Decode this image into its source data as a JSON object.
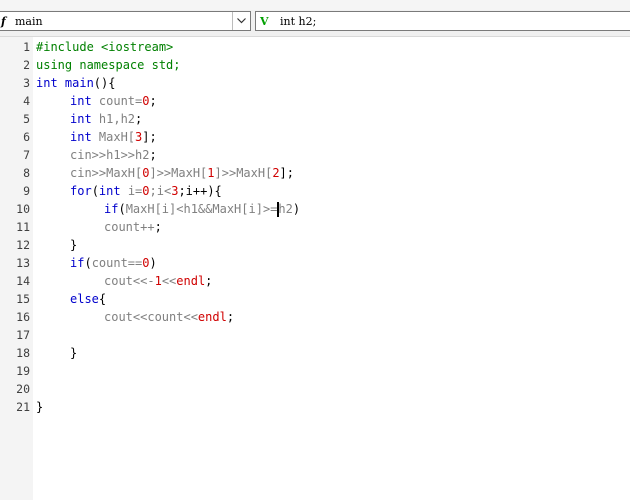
{
  "toolbar": {
    "function_combo": {
      "icon": "f",
      "value": "main"
    },
    "variable_combo": {
      "icon": "V",
      "value": "int h2;"
    }
  },
  "editor": {
    "lines": [
      {
        "n": "1",
        "indent": 0,
        "tokens": [
          {
            "t": "#include <iostream>",
            "c": "pp"
          }
        ]
      },
      {
        "n": "2",
        "indent": 0,
        "tokens": [
          {
            "t": "using namespace ",
            "c": "pp"
          },
          {
            "t": "std;",
            "c": "pp"
          }
        ]
      },
      {
        "n": "3",
        "indent": 0,
        "tokens": [
          {
            "t": "int main",
            "c": "kw"
          },
          {
            "t": "(){",
            "c": "br"
          }
        ]
      },
      {
        "n": "4",
        "indent": 1,
        "tokens": [
          {
            "t": "int ",
            "c": "kw"
          },
          {
            "t": "count",
            "c": "id"
          },
          {
            "t": "=",
            "c": "id"
          },
          {
            "t": "0",
            "c": "num"
          },
          {
            "t": ";",
            "c": "br"
          }
        ]
      },
      {
        "n": "5",
        "indent": 1,
        "tokens": [
          {
            "t": "int ",
            "c": "kw"
          },
          {
            "t": "h1,h2",
            "c": "id"
          },
          {
            "t": ";",
            "c": "br"
          }
        ]
      },
      {
        "n": "6",
        "indent": 1,
        "tokens": [
          {
            "t": "int ",
            "c": "kw"
          },
          {
            "t": "MaxH[",
            "c": "id"
          },
          {
            "t": "3",
            "c": "num"
          },
          {
            "t": "];",
            "c": "br"
          }
        ]
      },
      {
        "n": "7",
        "indent": 1,
        "tokens": [
          {
            "t": "cin>>h1>>h2",
            "c": "id"
          },
          {
            "t": ";",
            "c": "br"
          }
        ]
      },
      {
        "n": "8",
        "indent": 1,
        "tokens": [
          {
            "t": "cin>>MaxH[",
            "c": "id"
          },
          {
            "t": "0",
            "c": "num"
          },
          {
            "t": "]>>MaxH[",
            "c": "id"
          },
          {
            "t": "1",
            "c": "num"
          },
          {
            "t": "]>>MaxH[",
            "c": "id"
          },
          {
            "t": "2",
            "c": "num"
          },
          {
            "t": "];",
            "c": "br"
          }
        ]
      },
      {
        "n": "9",
        "indent": 1,
        "tokens": [
          {
            "t": "for",
            "c": "kw"
          },
          {
            "t": "(",
            "c": "br"
          },
          {
            "t": "int ",
            "c": "kw"
          },
          {
            "t": "i=",
            "c": "id"
          },
          {
            "t": "0",
            "c": "num"
          },
          {
            "t": ";i<",
            "c": "id"
          },
          {
            "t": "3",
            "c": "num"
          },
          {
            "t": ";i++){",
            "c": "br"
          }
        ]
      },
      {
        "n": "10",
        "indent": 2,
        "tokens": [
          {
            "t": "if",
            "c": "kw"
          },
          {
            "t": "(",
            "c": "br"
          },
          {
            "t": "MaxH[i]<h1&&MaxH[i]>=",
            "c": "id"
          },
          {
            "t": "|",
            "c": "caret"
          },
          {
            "t": "h2",
            "c": "id"
          },
          {
            "t": ")",
            "c": "br"
          }
        ]
      },
      {
        "n": "11",
        "indent": 2,
        "tokens": [
          {
            "t": "count++",
            "c": "id"
          },
          {
            "t": ";",
            "c": "br"
          }
        ]
      },
      {
        "n": "12",
        "indent": 1,
        "tokens": [
          {
            "t": "}",
            "c": "br"
          }
        ]
      },
      {
        "n": "13",
        "indent": 1,
        "tokens": [
          {
            "t": "if",
            "c": "kw"
          },
          {
            "t": "(",
            "c": "br"
          },
          {
            "t": "count==",
            "c": "id"
          },
          {
            "t": "0",
            "c": "num"
          },
          {
            "t": ")",
            "c": "br"
          }
        ]
      },
      {
        "n": "14",
        "indent": 2,
        "tokens": [
          {
            "t": "cout<<-",
            "c": "id"
          },
          {
            "t": "1",
            "c": "num"
          },
          {
            "t": "<<",
            "c": "id"
          },
          {
            "t": "endl",
            "c": "num"
          },
          {
            "t": ";",
            "c": "br"
          }
        ]
      },
      {
        "n": "15",
        "indent": 1,
        "tokens": [
          {
            "t": "else",
            "c": "kw"
          },
          {
            "t": "{",
            "c": "br"
          }
        ]
      },
      {
        "n": "16",
        "indent": 2,
        "tokens": [
          {
            "t": "cout<<count<<",
            "c": "id"
          },
          {
            "t": "endl",
            "c": "num"
          },
          {
            "t": ";",
            "c": "br"
          }
        ]
      },
      {
        "n": "17",
        "indent": 0,
        "tokens": []
      },
      {
        "n": "18",
        "indent": 1,
        "tokens": [
          {
            "t": "}",
            "c": "br"
          }
        ]
      },
      {
        "n": "19",
        "indent": 0,
        "tokens": []
      },
      {
        "n": "20",
        "indent": 0,
        "tokens": []
      },
      {
        "n": "21",
        "indent": 0,
        "tokens": [
          {
            "t": "}",
            "c": "br"
          }
        ]
      }
    ]
  }
}
